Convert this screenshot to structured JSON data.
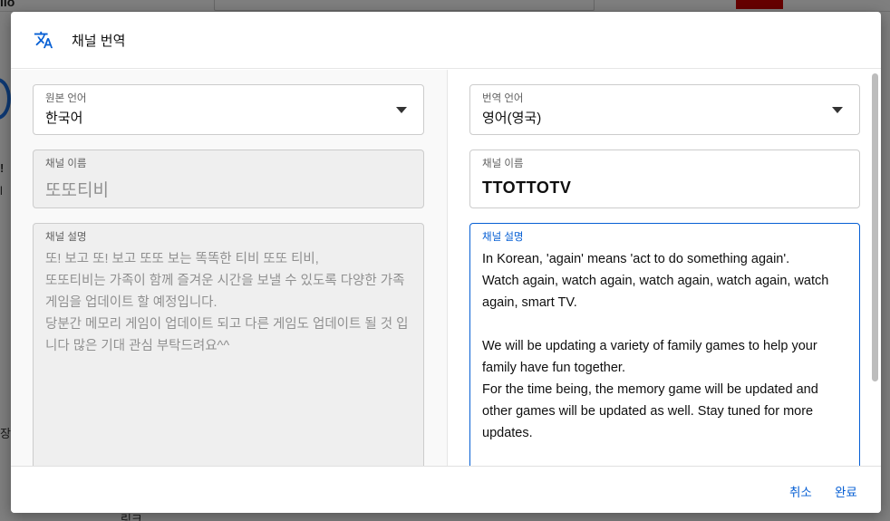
{
  "background": {
    "logo_fragment": "ılo",
    "left_fragments": [
      "!",
      "l",
      "장"
    ],
    "bottom_fragment": "링크"
  },
  "dialog": {
    "title": "채널 번역",
    "icon": "translate-icon"
  },
  "source": {
    "language_label": "원본 언어",
    "language_value": "한국어",
    "name_label": "채널 이름",
    "name_value": "또또티비",
    "description_label": "채널 설명",
    "description_value": "또! 보고 또! 보고 또또 보는 똑똑한 티비 또또 티비,\n또또티비는 가족이 함께 즐겨운 시간을 보낼 수 있도록 다양한 가족 게임을 업데이트 할 예정입니다.\n당분간 메모리 게임이 업데이트 되고 다른 게임도 업데이트 될 것 입니다 많은 기대 관심 부탁드려요^^"
  },
  "target": {
    "language_label": "번역 언어",
    "language_value": "영어(영국)",
    "name_label": "채널 이름",
    "name_value": "TTOTTOTV",
    "description_label": "채널 설명",
    "description_value": "In Korean, 'again' means 'act to do something again'.\nWatch again, watch again, watch again, watch again, watch again, smart TV.\n\nWe will be updating a variety of family games to help your family have fun together.\nFor the time being, the memory game will be updated and other games will be updated as well. Stay tuned for more updates."
  },
  "footer": {
    "cancel_label": "취소",
    "done_label": "완료"
  },
  "colors": {
    "accent": "#065fd4",
    "disabled_bg": "#efefef"
  }
}
